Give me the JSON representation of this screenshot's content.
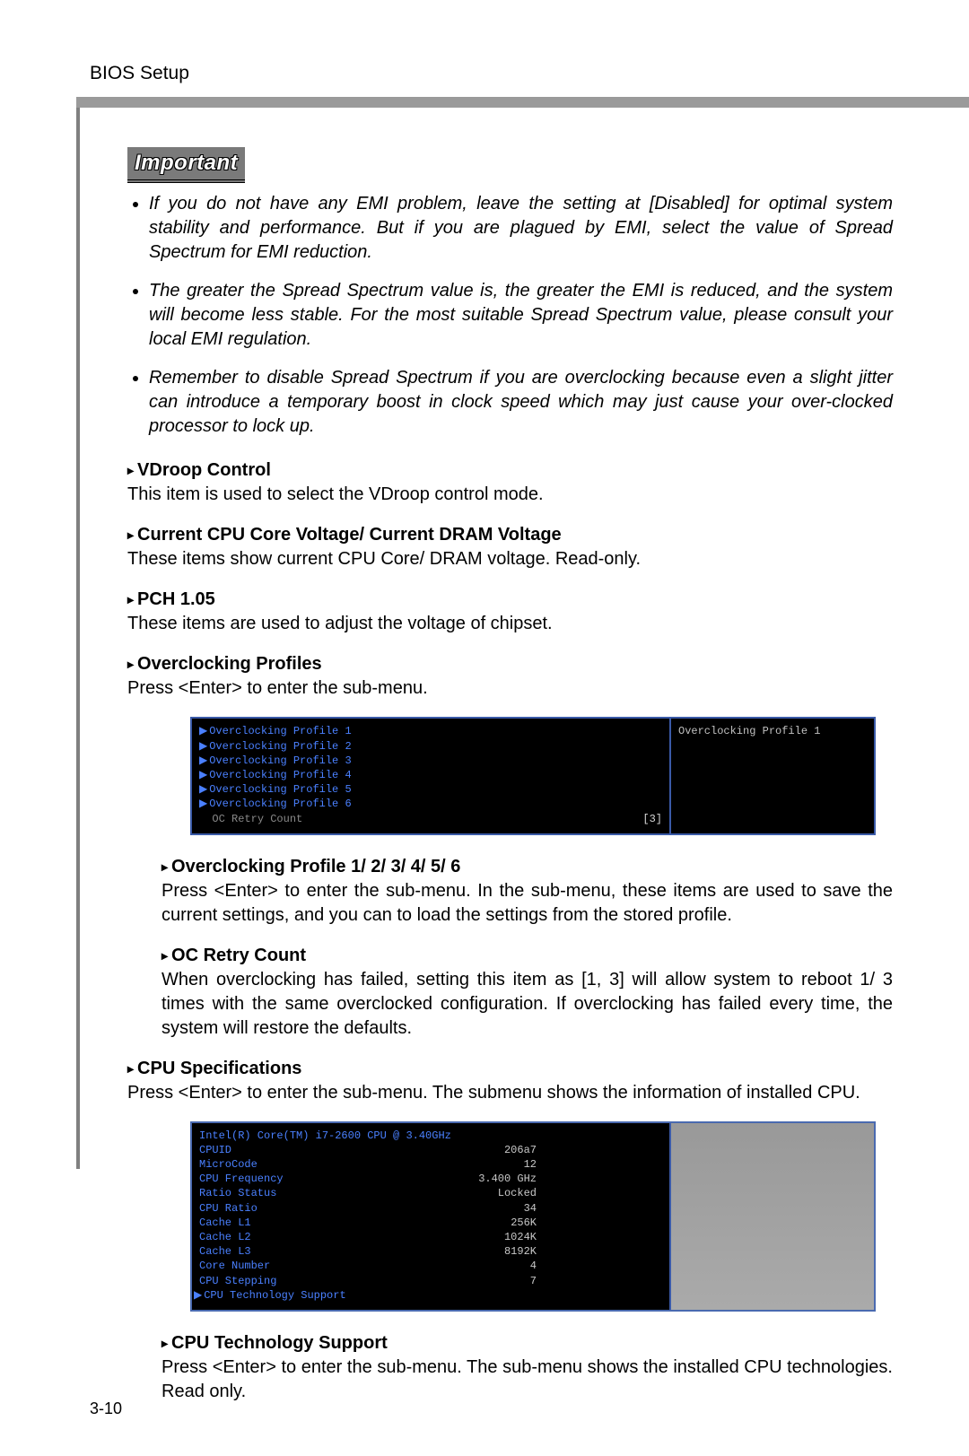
{
  "header": {
    "section": "BIOS Setup"
  },
  "important": {
    "badge": "Important",
    "notes": [
      "If you do not have any EMI problem, leave the setting at [Disabled] for optimal system stability and performance. But if you are plagued by EMI, select the value of Spread Spectrum for EMI reduction.",
      "The greater the Spread Spectrum value is, the greater the EMI is reduced, and the system will become less stable. For the most suitable Spread Spectrum value, please consult your local EMI regulation.",
      "Remember to disable Spread Spectrum if you are overclocking because even a slight jitter can introduce a temporary boost in clock speed which may just cause your over-clocked processor to lock up."
    ]
  },
  "settings": {
    "vdroop": {
      "title": "VDroop Control",
      "desc": "This item is used to select the VDroop control mode."
    },
    "voltage": {
      "title": "Current CPU Core Voltage/ Current DRAM Voltage",
      "desc": "These items show current CPU Core/ DRAM voltage. Read-only."
    },
    "pch": {
      "title": "PCH 1.05",
      "desc": "These items are used to adjust the voltage of chipset."
    },
    "oc_profiles": {
      "title": "Overclocking Profiles",
      "desc": "Press <Enter> to enter the sub-menu."
    },
    "oc_profile_n": {
      "title": "Overclocking Profile 1/ 2/ 3/ 4/ 5/ 6",
      "desc": "Press <Enter> to enter the sub-menu. In the sub-menu, these items are used to save the current settings, and you can to load the settings from the stored profile."
    },
    "oc_retry": {
      "title": "OC Retry Count",
      "desc": "When overclocking has failed, setting this item as [1, 3] will allow system to reboot 1/ 3 times with the same overclocked configuration. If overclocking has failed every time, the system will restore the defaults."
    },
    "cpu_spec": {
      "title": "CPU Specifications",
      "desc": "Press <Enter> to enter the sub-menu. The submenu shows the information of installed CPU."
    },
    "cpu_tech": {
      "title": "CPU Technology Support",
      "desc": "Press <Enter> to enter the sub-menu. The sub-menu shows the installed CPU technologies. Read only."
    }
  },
  "bios1": {
    "items": [
      "Overclocking Profile 1",
      "Overclocking Profile 2",
      "Overclocking Profile 3",
      "Overclocking Profile 4",
      "Overclocking Profile 5",
      "Overclocking Profile 6"
    ],
    "retry_label": "OC Retry Count",
    "retry_value": "[3]",
    "side": "Overclocking Profile 1"
  },
  "bios2": {
    "header": "Intel(R) Core(TM) i7-2600 CPU @ 3.40GHz",
    "rows": [
      {
        "label": "CPUID",
        "value": "206a7"
      },
      {
        "label": "MicroCode",
        "value": "12"
      },
      {
        "label": "CPU Frequency",
        "value": "3.400 GHz"
      },
      {
        "label": "Ratio Status",
        "value": "Locked"
      },
      {
        "label": "CPU Ratio",
        "value": "34"
      },
      {
        "label": "Cache L1",
        "value": "256K"
      },
      {
        "label": "Cache L2",
        "value": "1024K"
      },
      {
        "label": "Cache L3",
        "value": "8192K"
      },
      {
        "label": "Core Number",
        "value": "4"
      },
      {
        "label": "CPU Stepping",
        "value": "7"
      }
    ],
    "footer": "CPU Technology Support"
  },
  "footer": {
    "pagenum": "3-10"
  }
}
